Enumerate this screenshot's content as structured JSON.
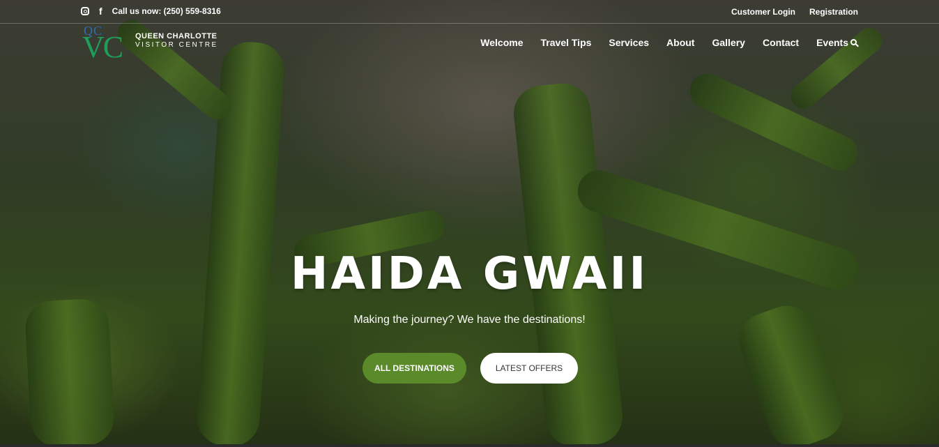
{
  "topbar": {
    "phone": "Call us now: (250) 559-8316",
    "customer_login": "Customer Login",
    "registration": "Registration"
  },
  "logo": {
    "mark_top": "QC",
    "mark_main": "VC",
    "line1": "QUEEN CHARLOTTE",
    "line2": "VISITOR CENTRE"
  },
  "nav": {
    "items": [
      "Welcome",
      "Travel Tips",
      "Services",
      "About",
      "Gallery",
      "Contact",
      "Events"
    ]
  },
  "hero": {
    "title": "HAIDA GWAII",
    "subtitle": "Making the journey? We have the destinations!",
    "primary_button": "ALL DESTINATIONS",
    "secondary_button": "LATEST OFFERS"
  },
  "colors": {
    "accent_green": "#5a8a2a",
    "logo_blue": "#2d6fb5",
    "logo_green": "#1e9e5a"
  }
}
